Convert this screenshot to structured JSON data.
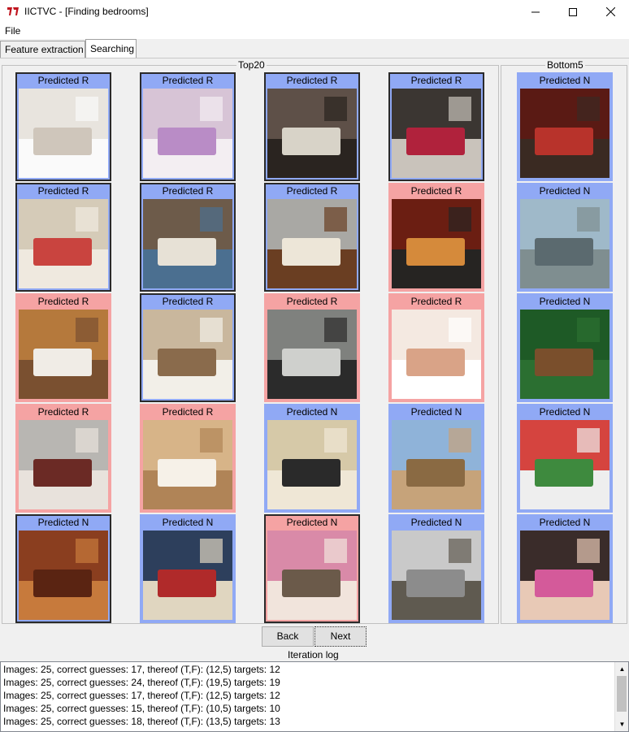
{
  "window": {
    "title": "IICTVC - [Finding bedrooms]"
  },
  "menu": {
    "file": "File"
  },
  "tabs": [
    {
      "label": "Feature extraction"
    },
    {
      "label": "Searching"
    }
  ],
  "groups": {
    "top": "Top20",
    "bottom": "Bottom5"
  },
  "cards_top": [
    {
      "label": "Predicted R",
      "color": "N",
      "selected": true,
      "thumb": "attic-bedroom"
    },
    {
      "label": "Predicted R",
      "color": "N",
      "selected": true,
      "thumb": "pink-bedroom"
    },
    {
      "label": "Predicted R",
      "color": "N",
      "selected": true,
      "thumb": "small-bedroom"
    },
    {
      "label": "Predicted R",
      "color": "N",
      "selected": true,
      "thumb": "dark-bedroom"
    },
    {
      "label": "Predicted R",
      "color": "N",
      "selected": true,
      "thumb": "quilt-bedroom"
    },
    {
      "label": "Predicted R",
      "color": "N",
      "selected": true,
      "thumb": "bedroom-window"
    },
    {
      "label": "Predicted R",
      "color": "N",
      "selected": true,
      "thumb": "wood-floor-bedroom"
    },
    {
      "label": "Predicted R",
      "color": "R",
      "selected": false,
      "thumb": "cat-speaker"
    },
    {
      "label": "Predicted R",
      "color": "R",
      "selected": false,
      "thumb": "kitchen"
    },
    {
      "label": "Predicted R",
      "color": "N",
      "selected": true,
      "thumb": "living-room"
    },
    {
      "label": "Predicted R",
      "color": "R",
      "selected": false,
      "thumb": "corridor"
    },
    {
      "label": "Predicted R",
      "color": "R",
      "selected": false,
      "thumb": "spa-woman"
    },
    {
      "label": "Predicted R",
      "color": "R",
      "selected": false,
      "thumb": "salon"
    },
    {
      "label": "Predicted R",
      "color": "R",
      "selected": false,
      "thumb": "massage"
    },
    {
      "label": "Predicted N",
      "color": "N",
      "selected": false,
      "thumb": "dj-wedding"
    },
    {
      "label": "Predicted N",
      "color": "N",
      "selected": false,
      "thumb": "monument"
    },
    {
      "label": "Predicted N",
      "color": "N",
      "selected": true,
      "thumb": "bar-cabinet"
    },
    {
      "label": "Predicted N",
      "color": "N",
      "selected": false,
      "thumb": "books"
    },
    {
      "label": "Predicted N",
      "color": "R",
      "selected": true,
      "thumb": "pink-sofa"
    },
    {
      "label": "Predicted N",
      "color": "N",
      "selected": false,
      "thumb": "pickup-truck"
    }
  ],
  "cards_bottom": [
    {
      "label": "Predicted N",
      "color": "N",
      "selected": false,
      "thumb": "meat-market"
    },
    {
      "label": "Predicted N",
      "color": "N",
      "selected": false,
      "thumb": "kayak-river"
    },
    {
      "label": "Predicted N",
      "color": "N",
      "selected": false,
      "thumb": "baseball"
    },
    {
      "label": "Predicted N",
      "color": "N",
      "selected": false,
      "thumb": "baseball-collage"
    },
    {
      "label": "Predicted N",
      "color": "N",
      "selected": false,
      "thumb": "dancers"
    }
  ],
  "buttons": {
    "back": "Back",
    "next": "Next"
  },
  "log": {
    "label": "Iteration log",
    "lines": [
      "Images: 25, correct guesses: 17, thereof (T,F): (12,5) targets: 12",
      "Images: 25, correct guesses: 24, thereof (T,F): (19,5) targets: 19",
      "Images: 25, correct guesses: 17, thereof (T,F): (12,5) targets: 12",
      "Images: 25, correct guesses: 15, thereof (T,F): (10,5) targets: 10",
      "Images: 25, correct guesses: 18, thereof (T,F): (13,5) targets: 13"
    ]
  },
  "colors": {
    "predicted_r_bg": "#f5a3a3",
    "predicted_n_bg": "#90a9f5"
  }
}
